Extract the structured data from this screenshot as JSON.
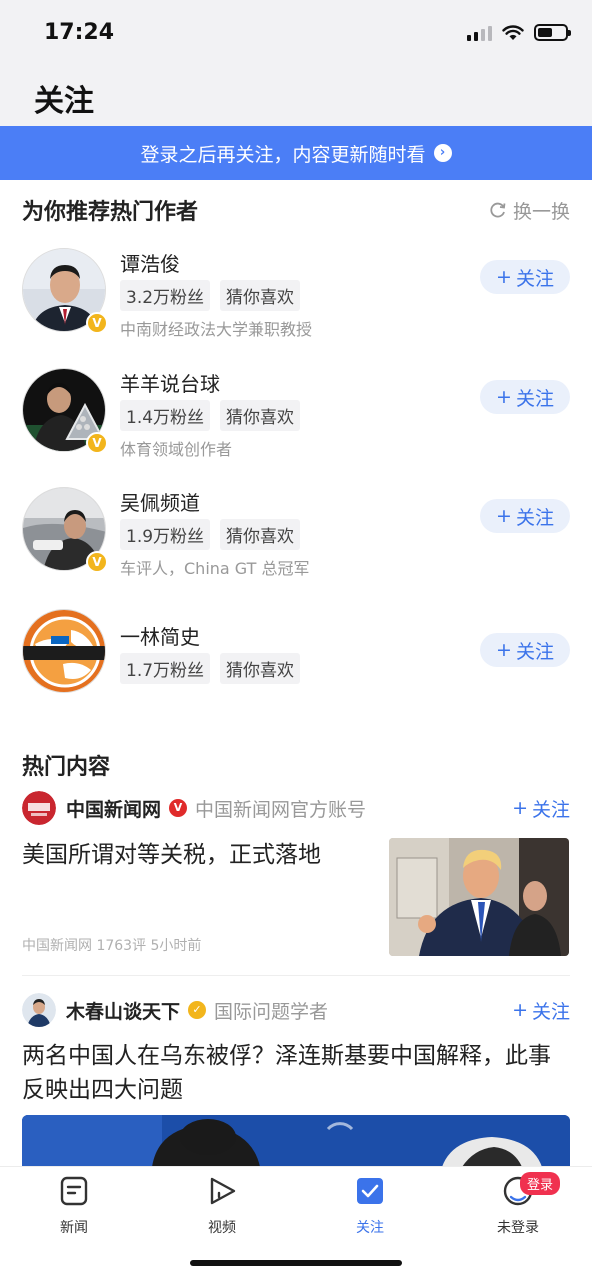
{
  "status": {
    "time": "17:24"
  },
  "header": {
    "title": "关注"
  },
  "banner": {
    "text": "登录之后再关注，内容更新随时看"
  },
  "recommend": {
    "title": "为你推荐热门作者",
    "refresh_label": "换一换",
    "follow_label": "关注",
    "authors": [
      {
        "name": "谭浩俊",
        "fans": "3.2万粉丝",
        "tag": "猜你喜欢",
        "desc": "中南财经政法大学兼职教授"
      },
      {
        "name": "羊羊说台球",
        "fans": "1.4万粉丝",
        "tag": "猜你喜欢",
        "desc": "体育领域创作者"
      },
      {
        "name": "吴佩频道",
        "fans": "1.9万粉丝",
        "tag": "猜你喜欢",
        "desc": "车评人，China GT 总冠军"
      },
      {
        "name": "一林简史",
        "fans": "1.7万粉丝",
        "tag": "猜你喜欢",
        "desc": ""
      }
    ]
  },
  "hot": {
    "title": "热门内容",
    "follow_label": "关注",
    "articles": [
      {
        "source": "中国新闻网",
        "source_desc": "中国新闻网官方账号",
        "title": "美国所谓对等关税，正式落地",
        "meta": "中国新闻网  1763评  5小时前"
      },
      {
        "source": "木春山谈天下",
        "source_desc": "国际问题学者",
        "title": "两名中国人在乌东被俘？泽连斯基要中国解释，此事反映出四大问题"
      }
    ]
  },
  "tabbar": {
    "tabs": [
      {
        "label": "新闻",
        "icon": "news-icon"
      },
      {
        "label": "视频",
        "icon": "video-icon"
      },
      {
        "label": "关注",
        "icon": "follow-icon"
      },
      {
        "label": "未登录",
        "icon": "profile-icon"
      }
    ],
    "login_badge": "登录"
  },
  "colors": {
    "accent": "#3b73ea",
    "banner": "#4b7ef6",
    "badge": "#f0314f"
  }
}
